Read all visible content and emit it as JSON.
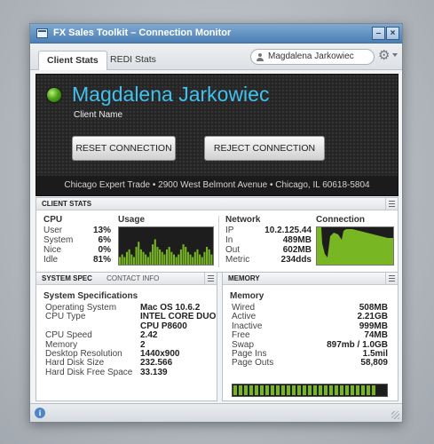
{
  "window": {
    "title": "FX Sales Toolkit – Connection Monitor"
  },
  "tabs": [
    "Client Stats",
    "REDI Stats"
  ],
  "search": {
    "value": "Magdalena Jarkowiec"
  },
  "client": {
    "name": "Magdalena Jarkowiec",
    "caption": "Client Name",
    "status_color": "#4ea418",
    "reset_label": "RESET CONNECTION",
    "reject_label": "REJECT CONNECTION",
    "address": "Chicago Expert Trade  •  2900 West Belmont Avenue  •  Chicago, IL 60618-5804"
  },
  "client_stats": {
    "heading": "CLIENT STATS",
    "cpu": {
      "title": "CPU",
      "usage_title": "Usage",
      "rows": [
        {
          "label": "User",
          "value": "13%"
        },
        {
          "label": "System",
          "value": "6%"
        },
        {
          "label": "Nice",
          "value": "0%"
        },
        {
          "label": "Idle",
          "value": "81%"
        }
      ],
      "usage_history": [
        3,
        4,
        3,
        5,
        6,
        4,
        3,
        7,
        9,
        6,
        5,
        4,
        3,
        5,
        8,
        10,
        7,
        6,
        5,
        4,
        6,
        7,
        5,
        4,
        3,
        4,
        6,
        8,
        7,
        5,
        4,
        3,
        5,
        6,
        4,
        3,
        5,
        7,
        6,
        4
      ]
    },
    "network": {
      "title": "Network",
      "connection_title": "Connection",
      "rows": [
        {
          "label": "IP",
          "value": "10.2.125.44"
        },
        {
          "label": "In",
          "value": "489MB"
        },
        {
          "label": "Out",
          "value": "602MB"
        },
        {
          "label": "Metric",
          "value": "234dds"
        }
      ]
    }
  },
  "system_spec": {
    "heading": "SYSTEM SPEC",
    "subheading": "CONTACT INFO",
    "title": "System Specifications",
    "rows": [
      {
        "label": "Operating System",
        "value": "Mac OS 10.6.2"
      },
      {
        "label": "CPU Type",
        "value": "INTEL CORE DUO"
      },
      {
        "label": "",
        "value": "CPU P8600"
      },
      {
        "label": "CPU Speed",
        "value": "2.42"
      },
      {
        "label": "Memory",
        "value": "2"
      },
      {
        "label": "Desktop Resolution",
        "value": "1440x900"
      },
      {
        "label": "Hard Disk Size",
        "value": "232.566"
      },
      {
        "label": "Hard Disk Free Space",
        "value": "33.139"
      }
    ]
  },
  "memory": {
    "heading": "MEMORY",
    "title": "Memory",
    "rows": [
      {
        "label": "Wired",
        "value": "508MB"
      },
      {
        "label": "Active",
        "value": "2.21GB"
      },
      {
        "label": "Inactive",
        "value": "999MB"
      },
      {
        "label": "Free",
        "value": "74MB"
      },
      {
        "label": "Swap",
        "value": "897mb / 1.0GB"
      },
      {
        "label": "Page Ins",
        "value": "1.5mil"
      },
      {
        "label": "Page Outs",
        "value": "58,809"
      }
    ],
    "usage_fraction": 0.96
  },
  "statusbar": {
    "info_icon": "info-icon"
  }
}
